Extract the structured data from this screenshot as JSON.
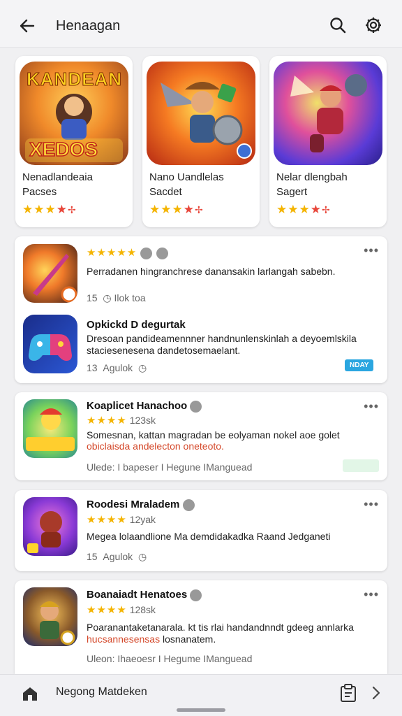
{
  "appbar": {
    "title": "Henaagan",
    "icons": [
      "back-arrow-icon",
      "search-icon",
      "gear-icon"
    ]
  },
  "featured": [
    {
      "name": "Nenadlandeaia",
      "sub": "Pacses",
      "art_title": "KANDEAN",
      "art_subtitle": "XEDOS"
    },
    {
      "name": "Nano Uandlelas",
      "sub": "Sacdet"
    },
    {
      "name": "Nelar dlengbah",
      "sub": "Sagert"
    }
  ],
  "list": [
    {
      "rows": [
        {
          "desc": "Perradanen hingranchrese danansakin larlangah sabebn.",
          "meta_count": "15",
          "meta_text": "Ilok toa"
        },
        {
          "title": "Opkickd D degurtak",
          "desc1": "Dresoan pandideamennner handnunlenskinlah a deyoemlskila",
          "desc2": "staciesenesena dandetosemaelant.",
          "meta_count": "13",
          "meta_text": "Agulok",
          "tag": "NDAY"
        }
      ]
    },
    {
      "title": "Koaplicet Hanachoo",
      "rating": "123sk",
      "desc": "Somesnan, kattan magradan be eolyaman nokel aoe golet",
      "red": "obiclaisda andelecton oneteoto.",
      "meta": "Ulede: I bapeser I Hegune IManguead"
    },
    {
      "title": "Roodesi Mraladem",
      "rating": "12yak",
      "desc": "Megea lolaandlione Ma demdidakadka Raand Jedganeti",
      "meta_count": "15",
      "meta_text": "Agulok"
    },
    {
      "title": "Boanaiadt Henatoes",
      "rating": "128sk",
      "desc": "Poaranantaketanarala. kt tis rlai handandnndt gdeeg annlarka",
      "red": "hucsannesensas",
      "red_rest": "losnanatem.",
      "meta": "Uleon: Ihaeoesr I Hegume IManguead"
    }
  ],
  "bottombar": {
    "label": "Negong Matdeken"
  }
}
